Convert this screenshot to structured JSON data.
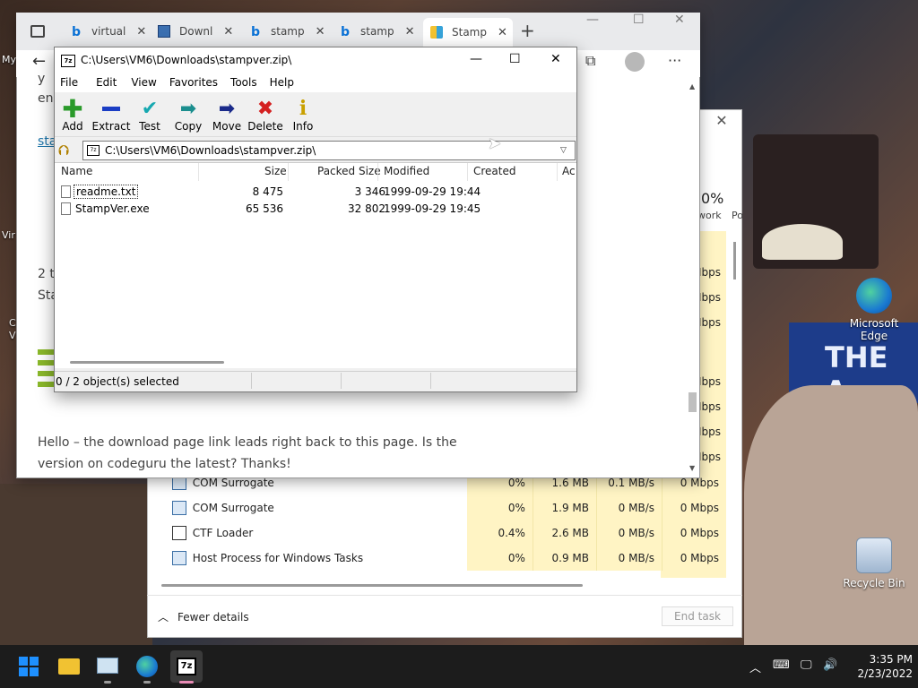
{
  "browser": {
    "tabs": [
      {
        "label": "virtual",
        "active": false,
        "favicon": "bing-icon"
      },
      {
        "label": "Downl",
        "active": false,
        "favicon": "download-page-icon"
      },
      {
        "label": "stamp",
        "active": false,
        "favicon": "bing-icon"
      },
      {
        "label": "stamp",
        "active": false,
        "favicon": "bing-icon"
      },
      {
        "label": "Stamp",
        "active": true,
        "favicon": "site-icon"
      }
    ],
    "content": {
      "partial_1": "y",
      "partial_2": "en",
      "partial_link": "sta",
      "partial_3": "2 t",
      "partial_4": "Sta",
      "comment_line_1": "Hello – the download page link leads right back to this page. Is the",
      "comment_line_2": "version on codeguru the latest? Thanks!"
    }
  },
  "sevenzip": {
    "title": "C:\\Users\\VM6\\Downloads\\stampver.zip\\",
    "menu": [
      "File",
      "Edit",
      "View",
      "Favorites",
      "Tools",
      "Help"
    ],
    "toolbar": [
      {
        "label": "Add",
        "icon": "plus-icon"
      },
      {
        "label": "Extract",
        "icon": "minus-icon"
      },
      {
        "label": "Test",
        "icon": "check-icon"
      },
      {
        "label": "Copy",
        "icon": "copy-arrow-icon"
      },
      {
        "label": "Move",
        "icon": "move-arrow-icon"
      },
      {
        "label": "Delete",
        "icon": "delete-x-icon"
      },
      {
        "label": "Info",
        "icon": "info-icon"
      }
    ],
    "address": "C:\\Users\\VM6\\Downloads\\stampver.zip\\",
    "columns": [
      "Name",
      "Size",
      "Packed Size",
      "Modified",
      "Created",
      "Ac"
    ],
    "files": [
      {
        "name": "readme.txt",
        "size": "8 475",
        "packed": "3 346",
        "modified": "1999-09-29 19:44"
      },
      {
        "name": "StampVer.exe",
        "size": "65 536",
        "packed": "32 802",
        "modified": "1999-09-29 19:45"
      }
    ],
    "status": "0 / 2 object(s) selected"
  },
  "taskmgr": {
    "network_pct": "0%",
    "network_label": "work",
    "power_label": "Po",
    "net_values_upper": [
      "Mbps",
      "Mbps",
      "Mbps"
    ],
    "net_values_mid": [
      "Mbps",
      "Mbps",
      "Mbps",
      "Mbps"
    ],
    "processes": [
      {
        "name": "COM Surrogate",
        "cpu": "0%",
        "memory": "1.6 MB",
        "disk": "0.1 MB/s",
        "network": "0 Mbps"
      },
      {
        "name": "COM Surrogate",
        "cpu": "0%",
        "memory": "1.9 MB",
        "disk": "0 MB/s",
        "network": "0 Mbps"
      },
      {
        "name": "CTF Loader",
        "cpu": "0.4%",
        "memory": "2.6 MB",
        "disk": "0 MB/s",
        "network": "0 Mbps"
      },
      {
        "name": "Host Process for Windows Tasks",
        "cpu": "0%",
        "memory": "0.9 MB",
        "disk": "0 MB/s",
        "network": "0 Mbps"
      }
    ],
    "fewer_details": "Fewer details",
    "end_task": "End task"
  },
  "desktop": {
    "icons": [
      {
        "label": "Microsoft Edge",
        "icon": "edge-icon"
      },
      {
        "label": "Recycle Bin",
        "icon": "recycle-bin-icon"
      }
    ],
    "left_partial_labels": [
      "My",
      "Vir",
      "C",
      "V"
    ]
  },
  "wallpaper_text": "THE A",
  "taskbar": {
    "time": "3:35 PM",
    "date": "2/23/2022",
    "pinned": [
      "start-icon",
      "file-explorer-icon",
      "task-manager-icon",
      "edge-icon",
      "sevenzip-icon"
    ]
  },
  "colors": {
    "taskmgr_highlight": "#fff4c4",
    "taskbar": "#1c1c1c",
    "sevenzip_title": "#ffffff"
  }
}
